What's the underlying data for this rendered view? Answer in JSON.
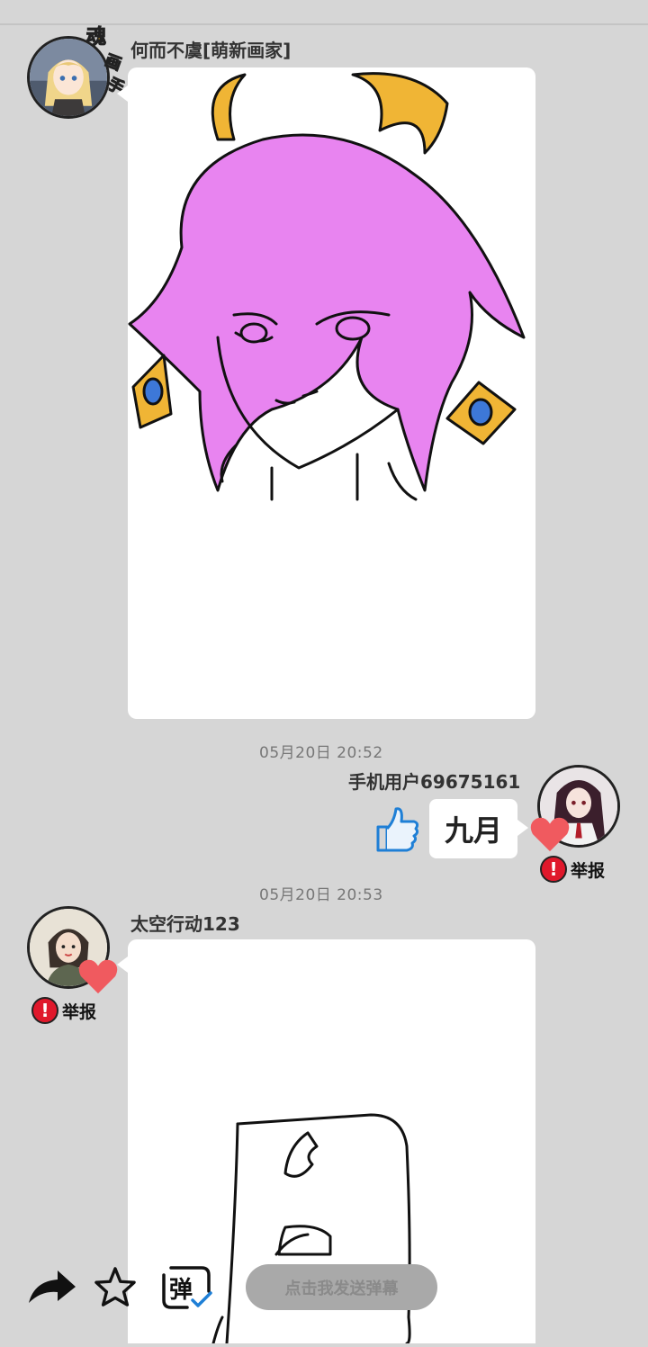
{
  "messages": [
    {
      "user": "何而不虞[萌新画家]",
      "badge": "魂画手",
      "type": "drawing"
    },
    {
      "timestamp": "05月20日  20:52",
      "user": "手机用户69675161",
      "text": "九月",
      "report_label": "举报"
    },
    {
      "timestamp": "05月20日  20:53",
      "user": "太空行动123",
      "report_label": "举报",
      "type": "drawing"
    }
  ],
  "bottom_bar": {
    "share_icon": "share-arrow-icon",
    "star_icon": "star-outline-icon",
    "danmaku_icon_label": "弹",
    "danmaku_placeholder": "点击我发送弹幕"
  },
  "colors": {
    "background": "#d6d6d6",
    "bubble": "#ffffff",
    "report_red": "#e0182b",
    "heart_red": "#f05a5f",
    "like_blue": "#1e7fd6",
    "hair_pink": "#e884f0",
    "horn_gold": "#f0b535"
  }
}
